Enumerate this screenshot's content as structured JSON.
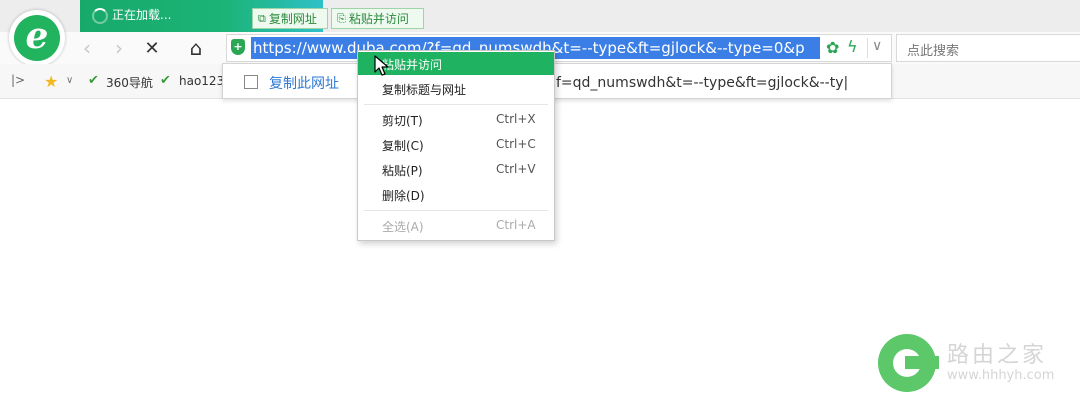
{
  "tab": {
    "title": "正在加载..."
  },
  "tab_actions": {
    "copy_url": "复制网址",
    "paste_visit": "粘贴并访问"
  },
  "address_bar": {
    "url": "https://www.duba.com/?f=qd_numswdh&t=--type&ft=gjlock&--type=0&p",
    "search_placeholder": "点此搜索"
  },
  "bookmarks": [
    {
      "label": "360导航"
    },
    {
      "label": "hao123"
    }
  ],
  "suggestion": {
    "copy_label": "复制此网址",
    "url_fragment": "f=qd_numswdh&t=--type&ft=gjlock&--ty|"
  },
  "context_menu": {
    "items": [
      {
        "label": "粘贴并访问",
        "shortcut": "",
        "highlighted": true,
        "disabled": false
      },
      {
        "label": "复制标题与网址",
        "shortcut": "",
        "highlighted": false,
        "disabled": false
      },
      {
        "label": "剪切(T)",
        "shortcut": "Ctrl+X",
        "highlighted": false,
        "disabled": false
      },
      {
        "label": "复制(C)",
        "shortcut": "Ctrl+C",
        "highlighted": false,
        "disabled": false
      },
      {
        "label": "粘贴(P)",
        "shortcut": "Ctrl+V",
        "highlighted": false,
        "disabled": false
      },
      {
        "label": "删除(D)",
        "shortcut": "",
        "highlighted": false,
        "disabled": false
      },
      {
        "label": "全选(A)",
        "shortcut": "Ctrl+A",
        "highlighted": false,
        "disabled": true
      }
    ]
  },
  "watermark": {
    "name": "路由之家",
    "site": "www.hhhyh.com"
  },
  "colors": {
    "accent": "#1fb260",
    "selection": "#3b7fe6",
    "link": "#2f7ad6"
  },
  "icons": [
    "browser-logo-icon",
    "back-icon",
    "forward-icon",
    "stop-icon",
    "home-icon",
    "shield-icon",
    "reload-icon",
    "bolt-icon",
    "dropdown-icon",
    "star-icon",
    "checkmark-icon",
    "copy-icon",
    "paste-icon",
    "cursor-icon"
  ]
}
